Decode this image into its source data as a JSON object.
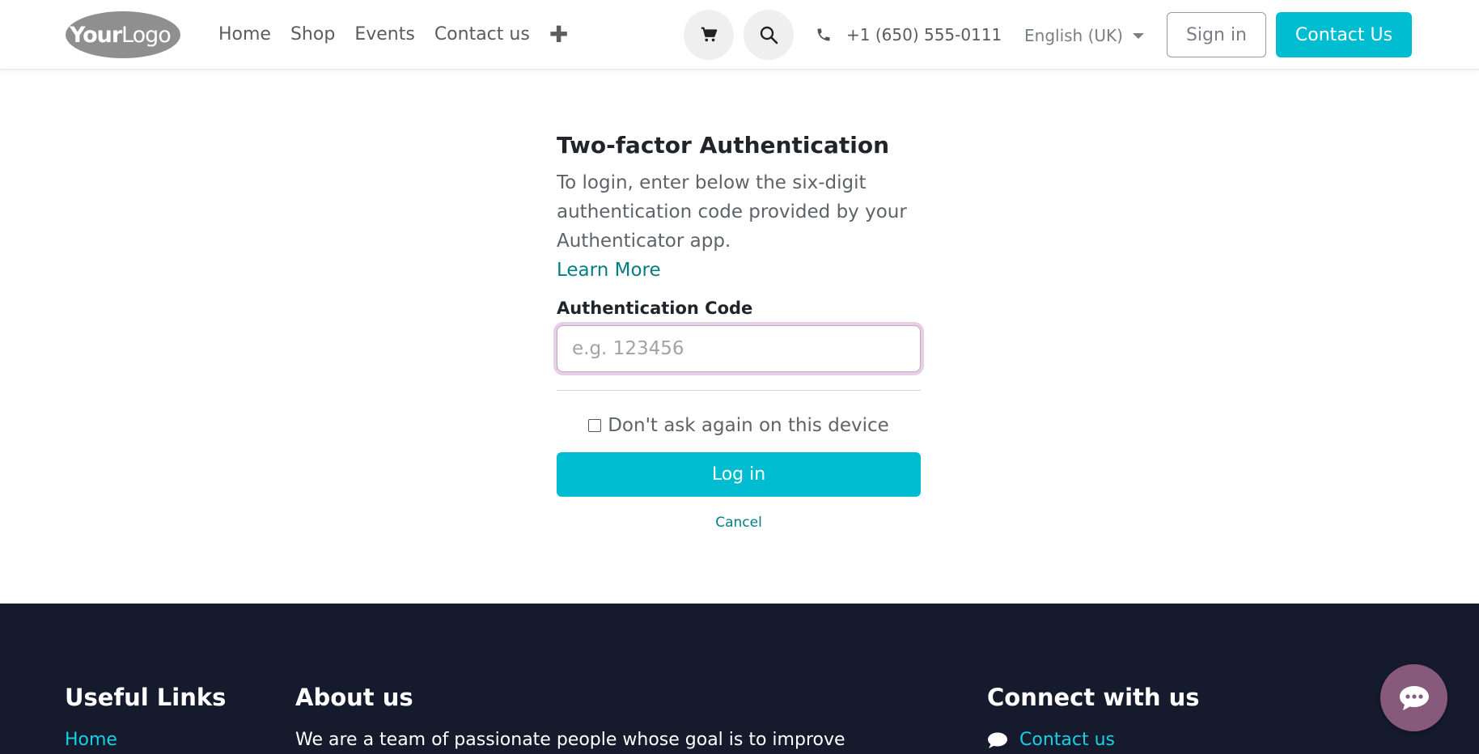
{
  "header": {
    "logo_text": "YourLogo",
    "nav": [
      "Home",
      "Shop",
      "Events",
      "Contact us"
    ],
    "add_icon": "plus-icon",
    "cart_icon": "cart-icon",
    "search_icon": "search-icon",
    "phone_icon": "phone-icon",
    "phone": "+1 (650) 555-0111",
    "language": "English (UK)",
    "signin_label": "Sign in",
    "contact_label": "Contact Us"
  },
  "form": {
    "title": "Two-factor Authentication",
    "description": "To login, enter below the six-digit authentication code provided by your Authenticator app.",
    "learn_more": "Learn More",
    "code_label": "Authentication Code",
    "code_placeholder": "e.g. 123456",
    "code_value": "",
    "remember_label": "Don't ask again on this device",
    "remember_checked": false,
    "login_label": "Log in",
    "cancel_label": "Cancel"
  },
  "footer": {
    "useful_links_title": "Useful Links",
    "useful_links_first": "Home",
    "about_title": "About us",
    "about_text": "We are a team of passionate people whose goal is to improve",
    "connect_title": "Connect with us",
    "connect_link": "Contact us"
  },
  "colors": {
    "accent": "#00bcd0",
    "link": "#017e84",
    "footer_bg": "#151a2d",
    "footer_link": "#14d1e6",
    "chat": "#875a7b"
  }
}
